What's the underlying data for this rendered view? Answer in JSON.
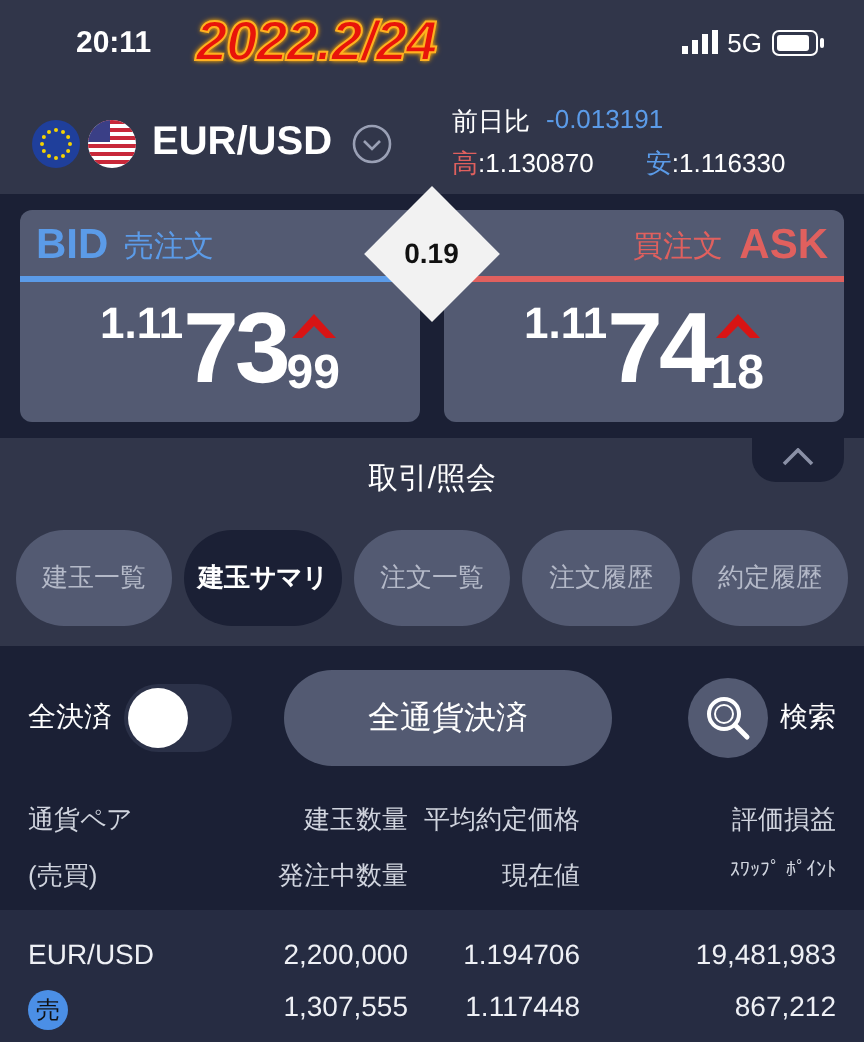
{
  "status_bar": {
    "time": "20:11",
    "date_stamp": "2022.2/24",
    "network": "5G"
  },
  "pair": {
    "name": "EUR/USD",
    "change_label": "前日比",
    "change_value": "-0.013191",
    "high_label": "高",
    "high_value": ":1.130870",
    "low_label": "安",
    "low_value": ":1.116330"
  },
  "quotes": [
    {
      "kind": "bid",
      "color": "#5b9be8",
      "label": "BID",
      "order": "売注文",
      "price_head": "1.11",
      "price_big": "73",
      "price_tail": "99",
      "rising": true
    },
    {
      "kind": "ask",
      "color": "#e0605e",
      "label": "ASK",
      "order": "買注文",
      "price_head": "1.11",
      "price_big": "74",
      "price_tail": "18",
      "rising": true
    }
  ],
  "spread": "0.19",
  "section_title": "取引/照会",
  "tabs": [
    {
      "label": "建玉一覧",
      "selected": false
    },
    {
      "label": "建玉サマリ",
      "selected": true
    },
    {
      "label": "注文一覧",
      "selected": false
    },
    {
      "label": "注文履歴",
      "selected": false
    },
    {
      "label": "約定履歴",
      "selected": false
    }
  ],
  "toolbar": {
    "toggle_label": "全決済",
    "toggle_on": false,
    "close_all_button": "全通貨決済",
    "search_label": "検索"
  },
  "table": {
    "header_top": [
      "通貨ペア",
      "建玉数量",
      "平均約定価格",
      "評価損益"
    ],
    "header_bottom": [
      "(売買)",
      "発注中数量",
      "現在値",
      "ｽﾜｯﾌﾟ ﾎﾟｲﾝﾄ"
    ],
    "rows": [
      {
        "pair": "EUR/USD",
        "side": "売",
        "quantity": "2,200,000",
        "avg_price": "1.194706",
        "pnl": "19,481,983",
        "pending": "1,307,555",
        "current": "1.117448",
        "swap": "867,212"
      }
    ]
  }
}
